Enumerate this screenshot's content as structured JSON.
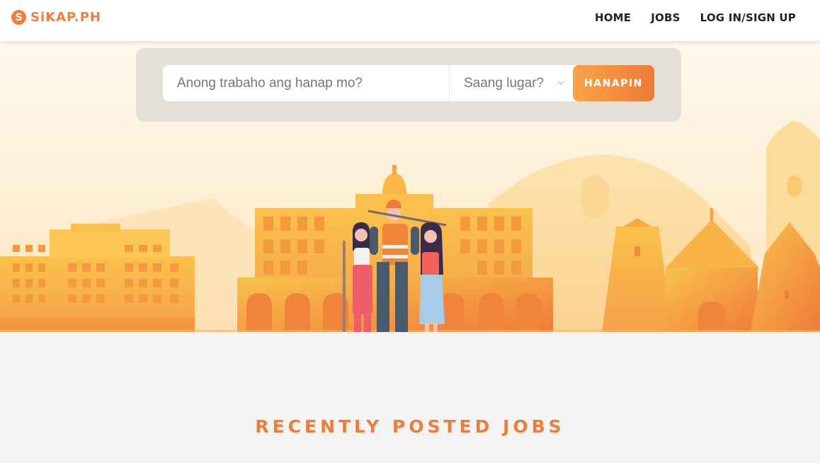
{
  "brand": {
    "logo_letter": "S",
    "name": "SiKAP.PH",
    "accent": "#ef7f3a"
  },
  "nav": {
    "items": [
      {
        "label": "HOME"
      },
      {
        "label": "JOBS"
      },
      {
        "label": "LOG IN/SIGN UP"
      }
    ]
  },
  "search": {
    "job_placeholder": "Anong trabaho ang hanap mo?",
    "location_label": "Saang lugar?",
    "button_label": "HANAPIN"
  },
  "section": {
    "title": "RECENTLY POSTED JOBS"
  },
  "icons": {
    "logo": "logo-s-icon",
    "dropdown": "chevron-down-icon"
  }
}
